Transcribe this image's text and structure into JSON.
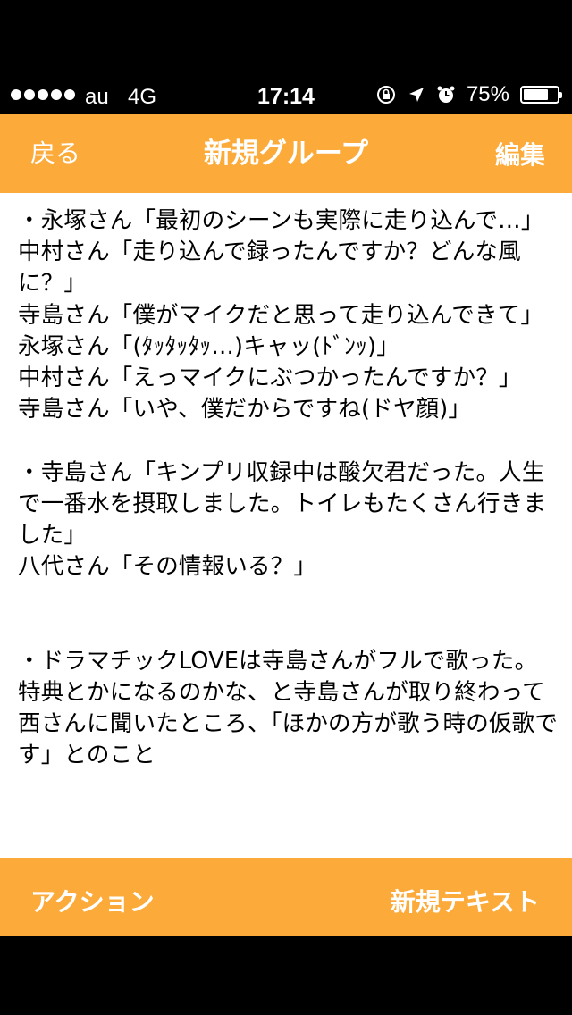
{
  "status_bar": {
    "carrier": "au",
    "network": "4G",
    "time": "17:14",
    "battery_percent": "75%",
    "battery_level": 0.75,
    "icons": [
      "orientation-lock-icon",
      "location-arrow-icon",
      "alarm-icon",
      "battery-icon"
    ]
  },
  "nav": {
    "back_label": "戻る",
    "title": "新規グループ",
    "edit_label": "編集"
  },
  "content": {
    "text": "・永塚さん「最初のシーンも実際に走り込んで…」\n中村さん「走り込んで録ったんですか？どんな風に？」\n寺島さん「僕がマイクだと思って走り込んできて」\n永塚さん「(ﾀｯﾀｯﾀｯ…)キャッ(ﾄﾞﾝｯ)」\n中村さん「えっマイクにぶつかったんですか？」\n寺島さん「いや、僕だからですね(ドヤ顔)」\n\n・寺島さん「キンプリ収録中は酸欠君だった。人生で一番水を摂取しました。トイレもたくさん行きました」\n八代さん「その情報いる？」\n\n\n・ドラマチックLOVEは寺島さんがフルで歌った。特典とかになるのかな、と寺島さんが取り終わって西さんに聞いたところ、「ほかの方が歌う時の仮歌です」とのこと"
  },
  "toolbar": {
    "action_label": "アクション",
    "new_text_label": "新規テキスト"
  },
  "colors": {
    "accent": "#fcab3b",
    "bar_text": "#ffffff",
    "background": "#ffffff"
  }
}
